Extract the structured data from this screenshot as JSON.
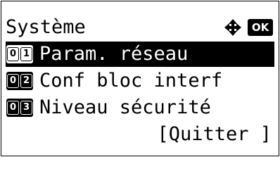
{
  "header": {
    "title": "Système",
    "nav_icon": "four-way-arrows-icon",
    "ok_icon_label": "OK"
  },
  "menu": {
    "items": [
      {
        "number": "01",
        "digits": [
          "0",
          "1"
        ],
        "label": "Param. réseau",
        "selected": true
      },
      {
        "number": "02",
        "digits": [
          "0",
          "2"
        ],
        "label": "Conf bloc interf",
        "selected": false
      },
      {
        "number": "03",
        "digits": [
          "0",
          "3"
        ],
        "label": "Niveau sécurité",
        "selected": false
      }
    ]
  },
  "footer": {
    "quit_label": "[Quitter ]"
  }
}
